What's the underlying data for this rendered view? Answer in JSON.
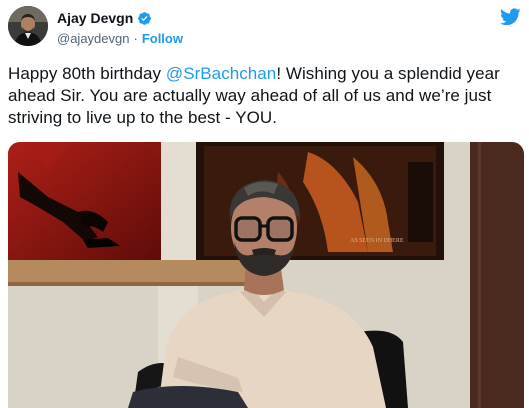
{
  "author": {
    "display_name": "Ajay Devgn",
    "handle": "@ajaydevgn",
    "separator": "·",
    "follow_label": "Follow",
    "verified_icon": "verified-badge-icon",
    "brand_icon": "twitter-bird-icon"
  },
  "tweet": {
    "text_before": "Happy 80th birthday ",
    "mention": "@SrBachchan",
    "text_after": "! Wishing you a splendid year ahead Sir. You are actually way ahead of all of us and we’re just striving to live up to the best - YOU."
  },
  "media": {
    "poster_caption": "AS SEEN IN DHERE"
  },
  "colors": {
    "accent": "#1d9bf0",
    "text": "#0f1419",
    "secondary": "#536471"
  }
}
